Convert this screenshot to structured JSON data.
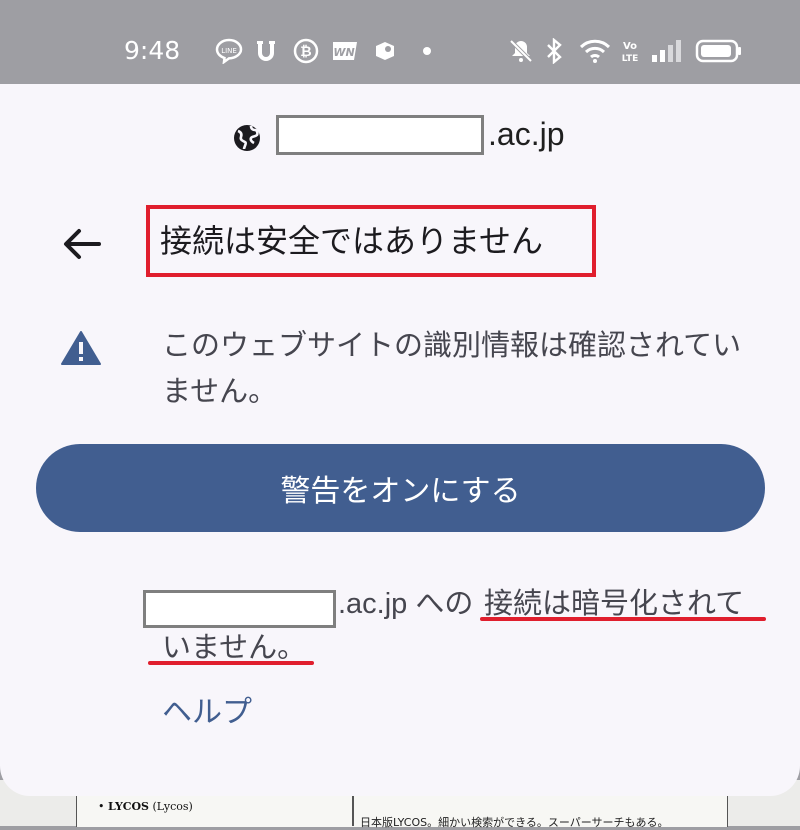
{
  "status_bar": {
    "time": "9:48",
    "icons": [
      "line-icon",
      "u-app-icon",
      "bitcoin-icon",
      "wn-icon",
      "app-icon",
      "dot-icon",
      "mute-icon",
      "bluetooth-icon",
      "wifi-icon",
      "volte-icon",
      "signal-icon",
      "battery-icon"
    ],
    "volte_text": "Vo LTE",
    "wn_text": "WN"
  },
  "sheet": {
    "site_suffix": ".ac.jp",
    "title": "接続は安全ではありません",
    "info_text": "このウェブサイトの識別情報は確認されていません。",
    "turn_on_button": "警告をオンにする",
    "body_domain": ".ac.jp への",
    "body_line1": "接続は暗号化されて",
    "body_line2": "いません。",
    "help_link": "ヘルプ"
  },
  "background_page": {
    "left_cell_bold": "LYCOS",
    "left_cell_text": "(Lycos)",
    "right_cell_text": "日本版LYCOS。細かい検索ができる。スーパーサーチもある。"
  },
  "colors": {
    "sheet_bg": "#f8f6fb",
    "status_bar_bg": "#9e9ea3",
    "primary": "#415e90",
    "highlight_red": "#e01e2d",
    "text_dark": "#1c1b1f",
    "text_body": "#46464f"
  }
}
